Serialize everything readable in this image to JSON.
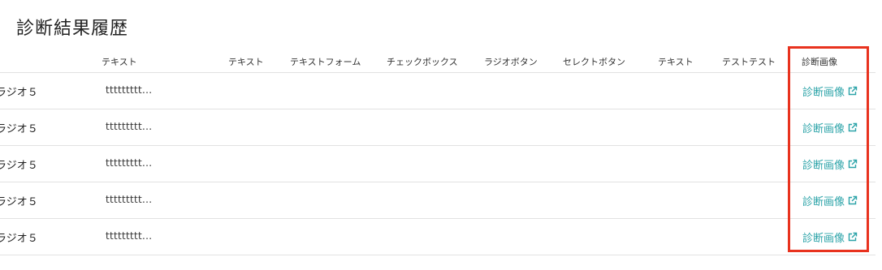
{
  "page": {
    "title": "診断結果履歴"
  },
  "table": {
    "headers": [
      "テキスト",
      "テキスト",
      "テキストフォーム",
      "チェックボックス",
      "ラジオボタン",
      "セレクトボタン",
      "テキスト",
      "テストテスト",
      "診断画像"
    ],
    "rows": [
      {
        "radio": "ラジオ５",
        "text": "ttttttttt...",
        "link": "診断画像"
      },
      {
        "radio": "ラジオ５",
        "text": "ttttttttt...",
        "link": "診断画像"
      },
      {
        "radio": "ラジオ５",
        "text": "ttttttttt...",
        "link": "診断画像"
      },
      {
        "radio": "ラジオ５",
        "text": "ttttttttt...",
        "link": "診断画像"
      },
      {
        "radio": "ラジオ５",
        "text": "ttttttttt...",
        "link": "診断画像"
      }
    ]
  },
  "icons": {
    "link": "external-link-icon"
  },
  "colors": {
    "link": "#2ba3a8",
    "highlight": "#e8321e",
    "divider": "#e2e2e2"
  }
}
